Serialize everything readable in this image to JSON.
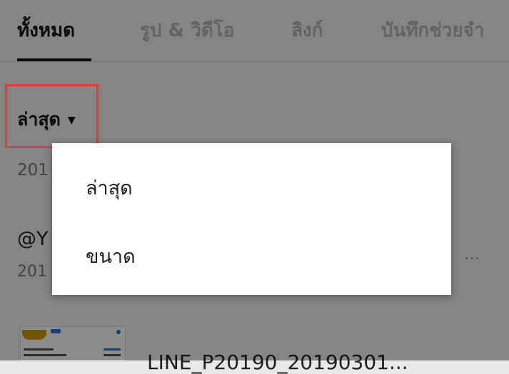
{
  "tabs": [
    {
      "label": "ทั้งหมด",
      "active": true
    },
    {
      "label": "รูป & วิดีโอ",
      "active": false
    },
    {
      "label": "ลิงก์",
      "active": false
    },
    {
      "label": "บันทึกช่วยจำ",
      "active": false
    }
  ],
  "sort": {
    "label": "ล่าสุด",
    "caret": "▼"
  },
  "list": {
    "date_partial": "201",
    "items": [
      {
        "title_partial": "@Y",
        "date_partial": "201",
        "more": "…"
      }
    ],
    "file_name_partial": "LINE_P20190_20190301..."
  },
  "menu": {
    "items": [
      {
        "label": "ล่าสุด"
      },
      {
        "label": "ขนาด"
      }
    ]
  },
  "colors": {
    "overlay": "#000000",
    "highlight": "#e63a3a",
    "thumbnail_accent": "#d59a00",
    "link_blue": "#2f73d8"
  }
}
